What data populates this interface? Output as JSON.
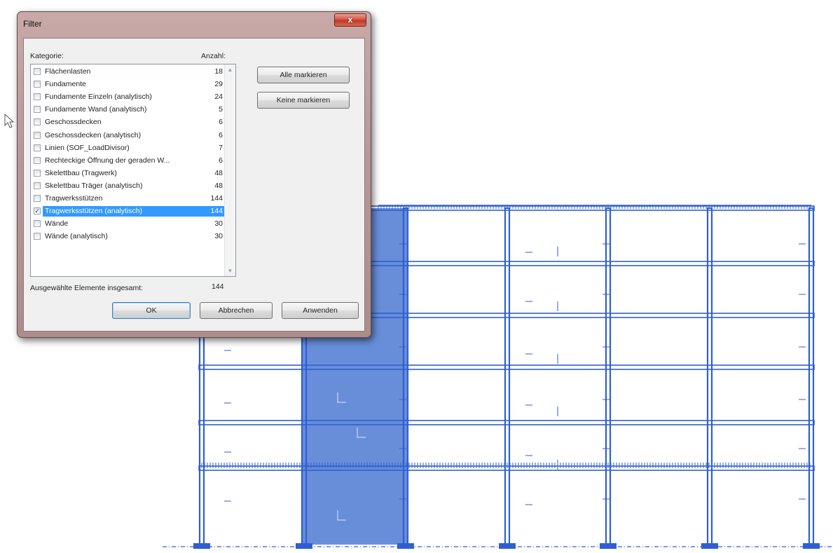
{
  "dialog": {
    "title": "Filter",
    "close_glyph": "x",
    "category_header": "Kategorie:",
    "count_header": "Anzahl:",
    "items": [
      {
        "label": "Flächenlasten",
        "count": "18",
        "checked": false
      },
      {
        "label": "Fundamente",
        "count": "29",
        "checked": false
      },
      {
        "label": "Fundamente Einzeln (analytisch)",
        "count": "24",
        "checked": false
      },
      {
        "label": "Fundamente Wand (analytisch)",
        "count": "5",
        "checked": false
      },
      {
        "label": "Geschossdecken",
        "count": "6",
        "checked": false
      },
      {
        "label": "Geschossdecken (analytisch)",
        "count": "6",
        "checked": false
      },
      {
        "label": "Linien (SOF_LoadDivisor)",
        "count": "7",
        "checked": false
      },
      {
        "label": "Rechteckige Öffnung der geraden W...",
        "count": "6",
        "checked": false
      },
      {
        "label": "Skelettbau (Tragwerk)",
        "count": "48",
        "checked": false
      },
      {
        "label": "Skelettbau Träger (analytisch)",
        "count": "48",
        "checked": false
      },
      {
        "label": "Tragwerksstützen",
        "count": "144",
        "checked": false
      },
      {
        "label": "Tragwerksstützen (analytisch)",
        "count": "144",
        "checked": true
      },
      {
        "label": "Wände",
        "count": "30",
        "checked": false
      },
      {
        "label": "Wände (analytisch)",
        "count": "30",
        "checked": false
      }
    ],
    "check_all_label": "Alle markieren",
    "check_none_label": "Keine markieren",
    "total_label": "Ausgewählte Elemente insgesamt:",
    "total_value": "144",
    "ok_label": "OK",
    "cancel_label": "Abbrechen",
    "apply_label": "Anwenden"
  },
  "colors": {
    "structure": "#2f5fd1",
    "highlight_fill": "#5b84d6",
    "selection": "#3399ff"
  },
  "icons": {
    "cursor": "arrow-cursor-icon",
    "close": "close-icon",
    "scroll_up": "scroll-up-icon",
    "scroll_down": "scroll-down-icon"
  }
}
